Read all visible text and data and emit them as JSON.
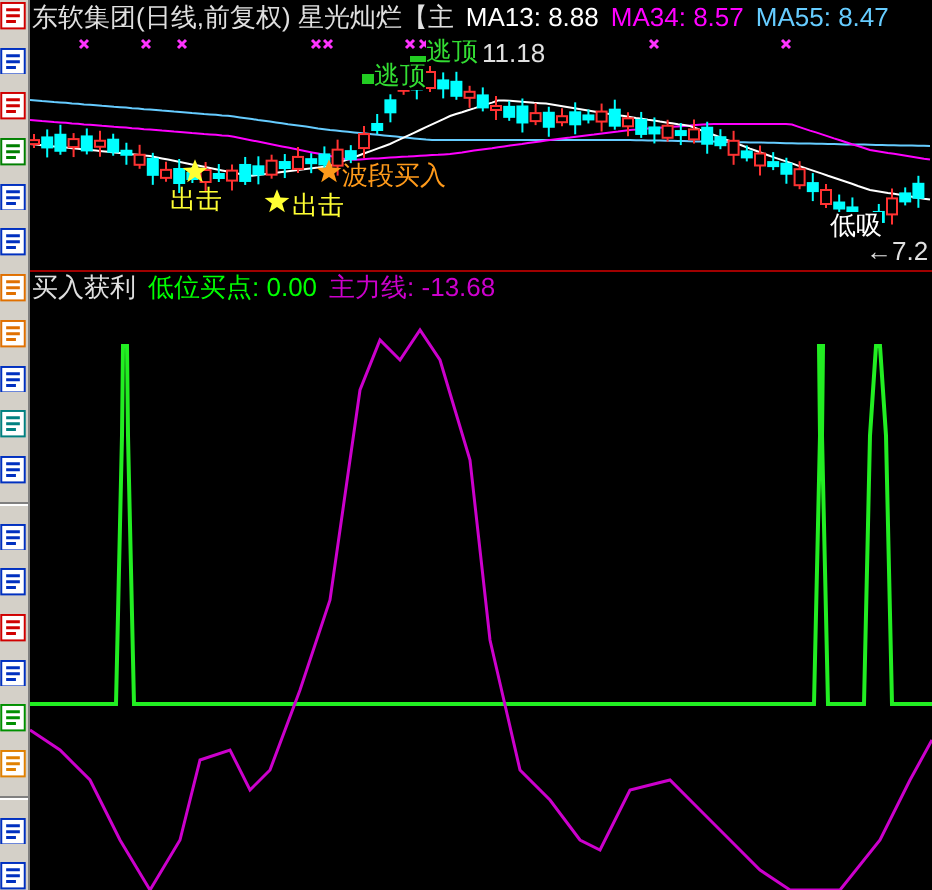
{
  "title": "东软集团(日线,前复权) 星光灿烂【主",
  "indicators": [
    {
      "label": "MA13: 8.88",
      "color": "#ffffff"
    },
    {
      "label": "MA34: 8.57",
      "color": "#ff00ff"
    },
    {
      "label": "MA55: 8.47",
      "color": "#66ccff"
    }
  ],
  "chart_labels": [
    {
      "kind": "escape",
      "text": "逃顶"
    },
    {
      "kind": "escape",
      "text": "逃顶"
    },
    {
      "kind": "price",
      "text": "11.18"
    },
    {
      "kind": "strike",
      "text": "出击"
    },
    {
      "kind": "strike",
      "text": "出击"
    },
    {
      "kind": "buy",
      "text": "波段买入"
    },
    {
      "kind": "dip",
      "text": "低吸"
    },
    {
      "kind": "price",
      "text": "←7.2"
    }
  ],
  "lower_panel": {
    "name": "买入获利",
    "values": [
      {
        "label": "低位买点: 0.00",
        "color": "#00ff00"
      },
      {
        "label": "主力线: -13.68",
        "color": "#cc00cc"
      }
    ]
  }
}
